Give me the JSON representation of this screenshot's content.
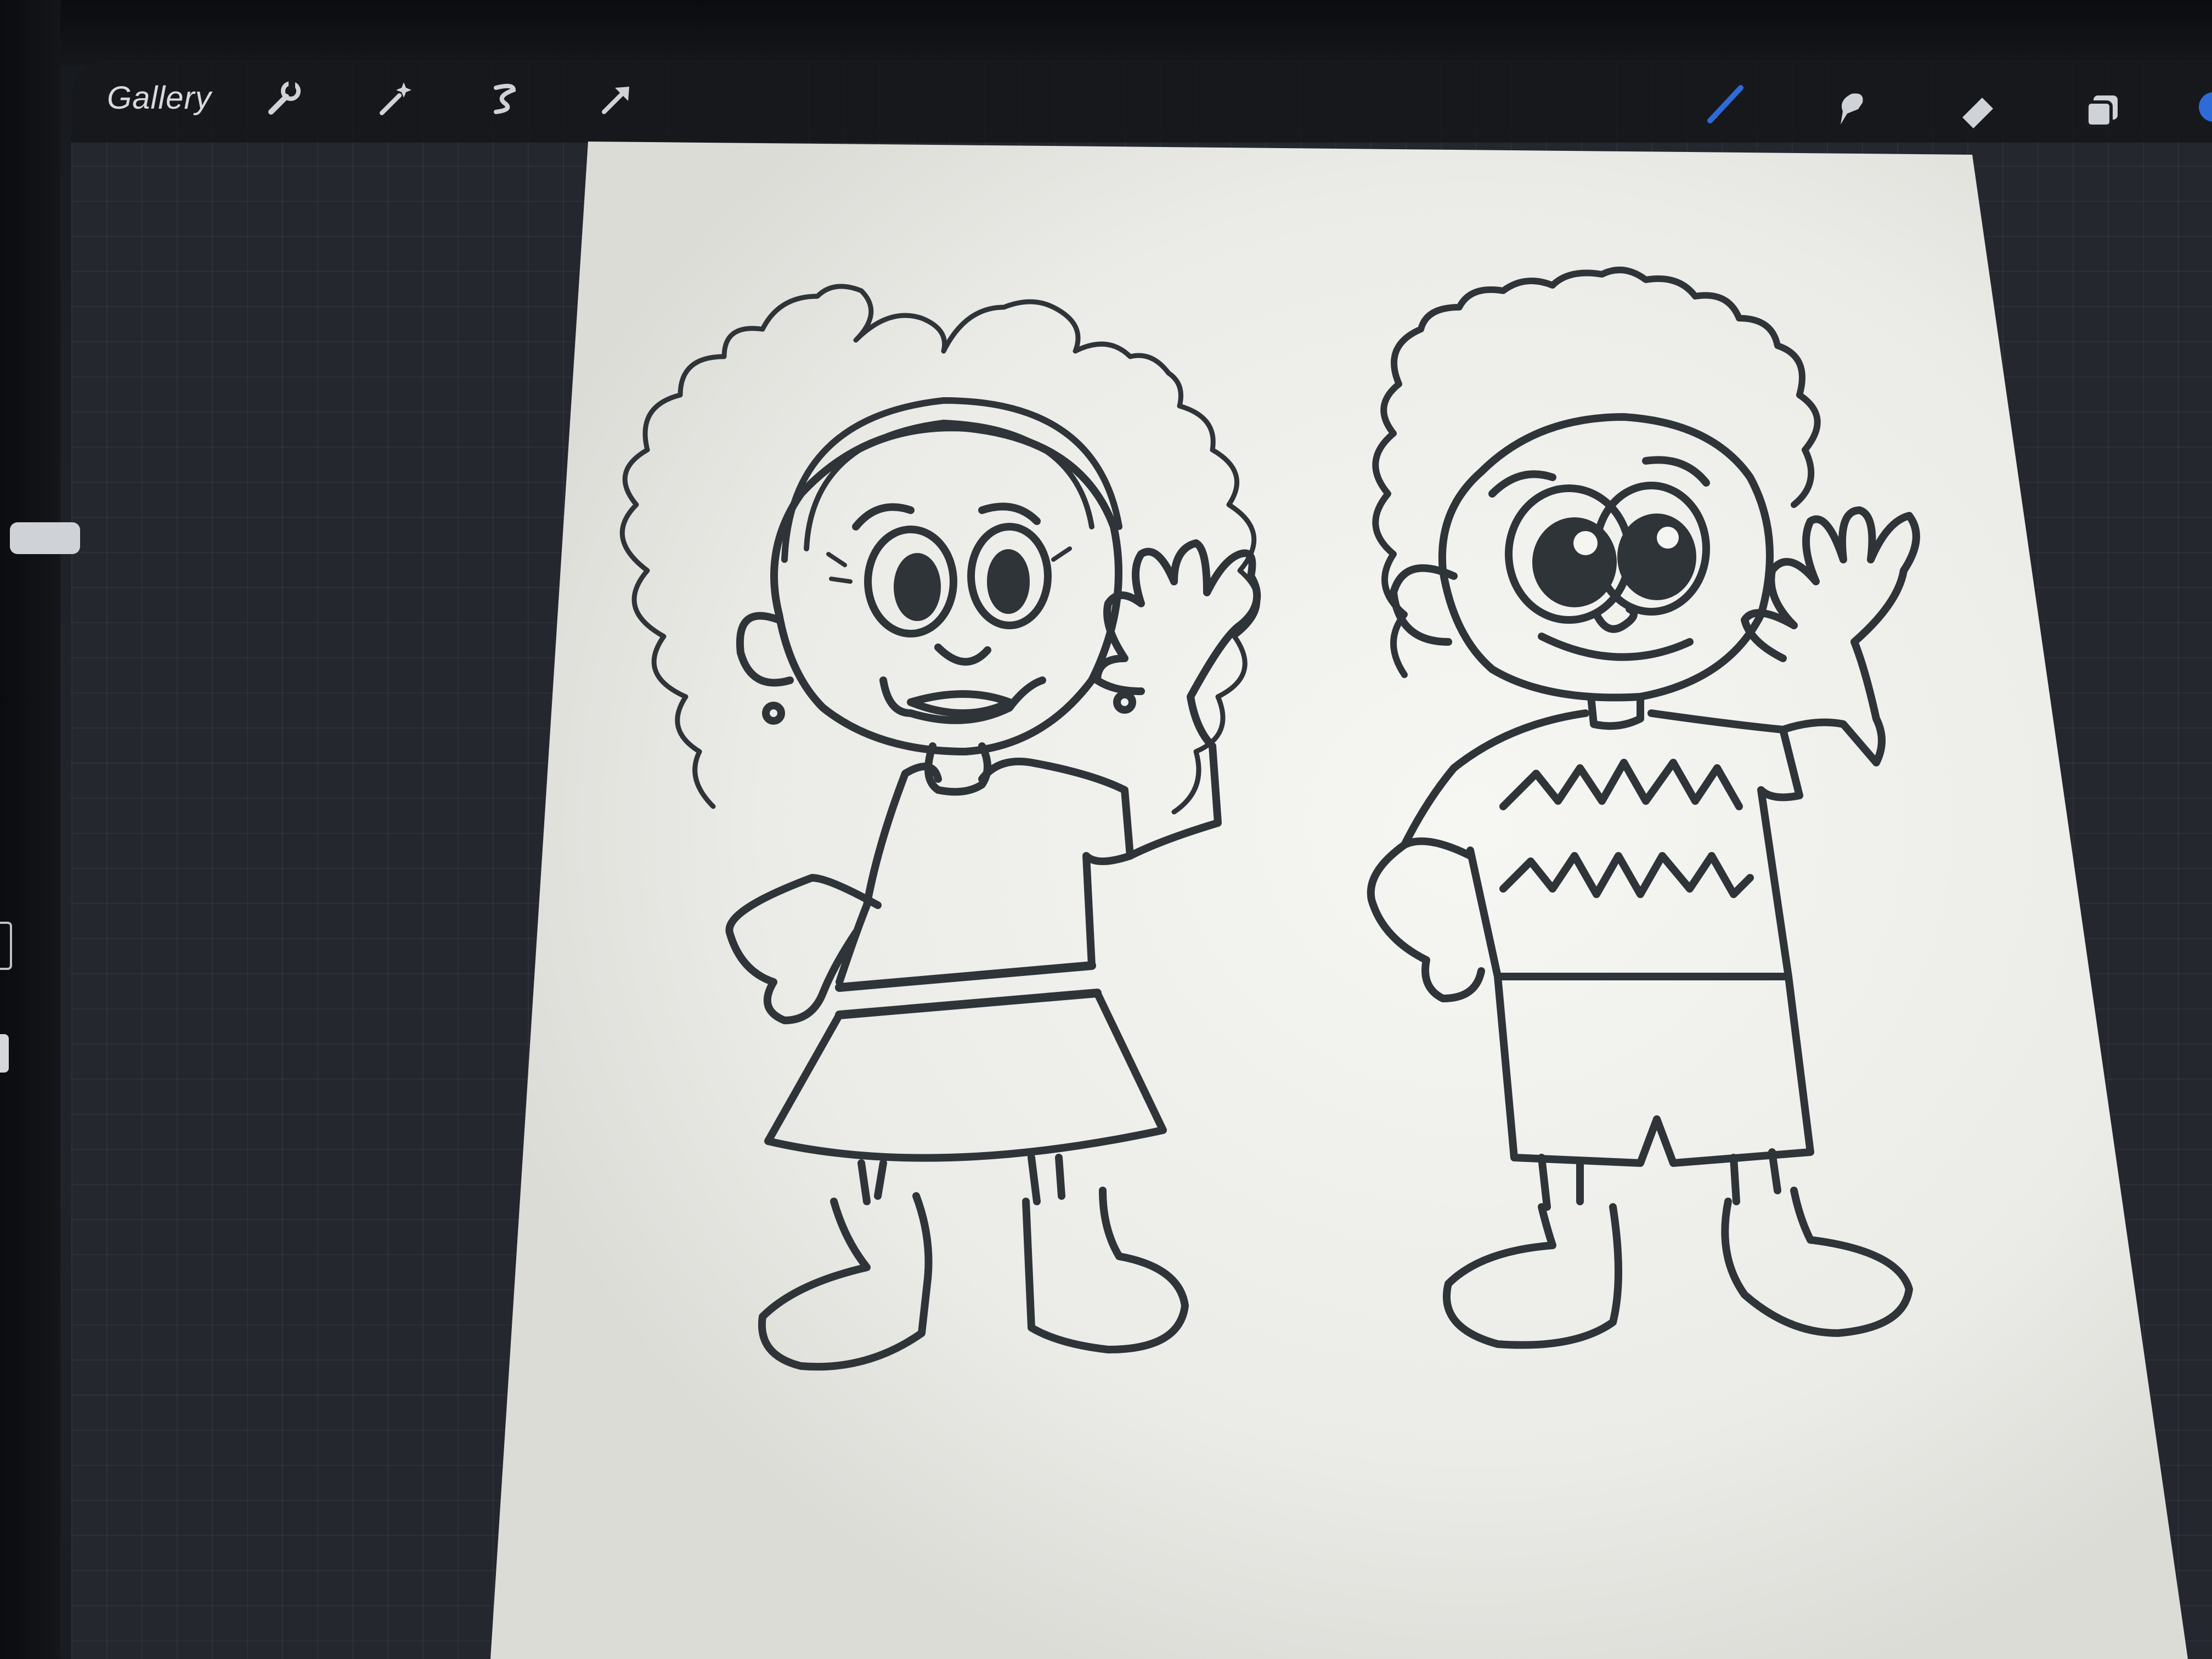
{
  "toolbar": {
    "gallery_label": "Gallery",
    "left_tools": [
      "wrench-icon",
      "magic-wand-icon",
      "selection-icon",
      "transform-arrow-icon"
    ],
    "right_tools": [
      "brush-icon",
      "smudge-icon",
      "eraser-icon",
      "layers-icon",
      "color-swatch-icon"
    ],
    "active_tool": "brush",
    "active_color": "#2f6bd8"
  },
  "canvas": {
    "background": "#ecece8",
    "ink_color": "#2e3438",
    "subjects": [
      "girl-character",
      "boy-character"
    ]
  }
}
